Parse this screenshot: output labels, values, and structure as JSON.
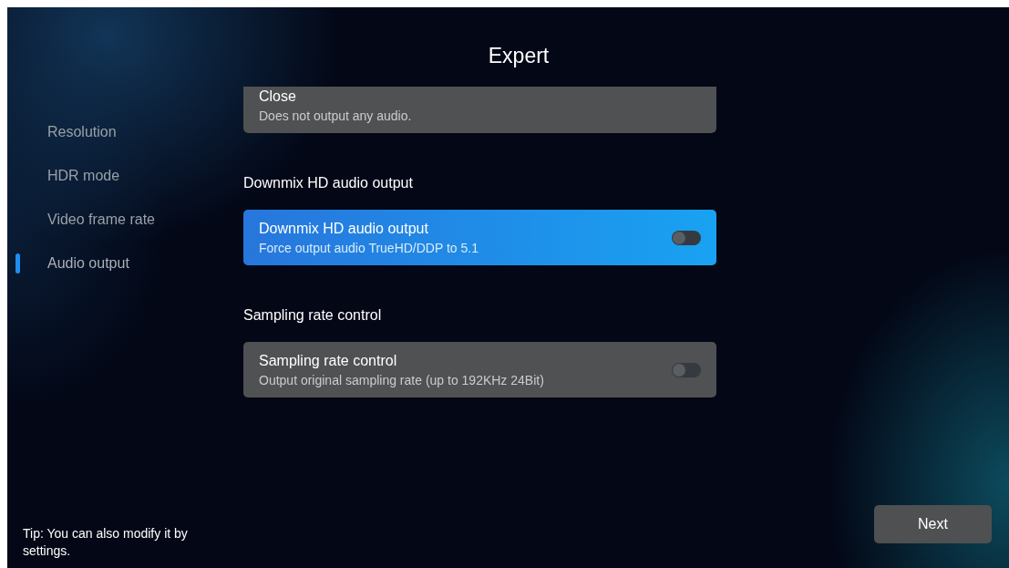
{
  "title": "Expert",
  "sidebar": {
    "items": [
      {
        "label": "Resolution",
        "selected": false
      },
      {
        "label": "HDR mode",
        "selected": false
      },
      {
        "label": "Video frame rate",
        "selected": false
      },
      {
        "label": "Audio output",
        "selected": true
      }
    ]
  },
  "content": [
    {
      "kind": "option",
      "title": "Close",
      "description": "Does not output any audio.",
      "selected": false
    },
    {
      "kind": "heading",
      "text": "Downmix HD audio output"
    },
    {
      "kind": "toggle",
      "title": "Downmix HD audio output",
      "description": "Force output audio TrueHD/DDP to 5.1",
      "selected": true,
      "on": false
    },
    {
      "kind": "heading",
      "text": "Sampling rate control"
    },
    {
      "kind": "toggle",
      "title": "Sampling rate control",
      "description": "Output original sampling rate (up to 192KHz 24Bit)",
      "selected": false,
      "on": false
    }
  ],
  "tip": "Tip: You can also modify it by settings.",
  "next_button": "Next"
}
